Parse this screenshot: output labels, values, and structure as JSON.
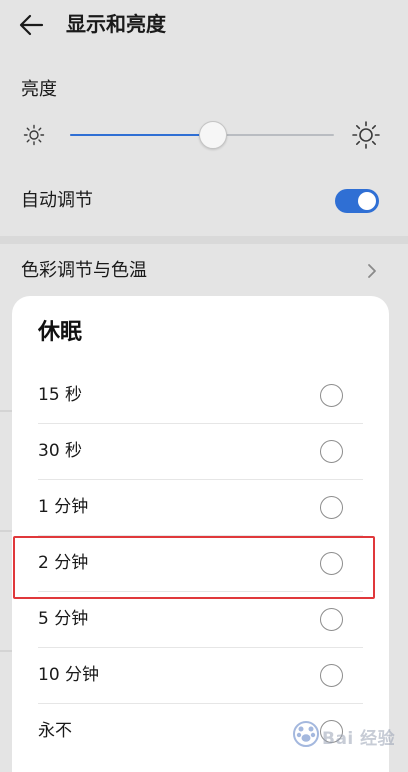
{
  "header": {
    "title": "显示和亮度",
    "back_icon": "arrow-left-icon"
  },
  "brightness": {
    "label": "亮度",
    "level": 0.54,
    "accent_color": "#2f6fd4",
    "min_icon": "sun-small-icon",
    "max_icon": "sun-large-icon"
  },
  "auto_adjust": {
    "label": "自动调节",
    "enabled": true
  },
  "color_setting": {
    "label": "色彩调节与色温",
    "icon": "chevron-right-icon"
  },
  "sleep_dialog": {
    "title": "休眠",
    "options": [
      {
        "label": "15 秒"
      },
      {
        "label": "30 秒"
      },
      {
        "label": "1 分钟"
      },
      {
        "label": "2 分钟"
      },
      {
        "label": "5 分钟"
      },
      {
        "label": "10 分钟"
      },
      {
        "label": "永不"
      }
    ],
    "highlight_color": "#e0383b"
  },
  "watermark": {
    "text": "Bai 经验"
  }
}
